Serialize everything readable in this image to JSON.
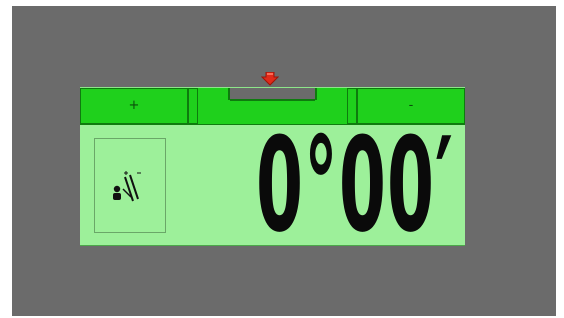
{
  "panel": {
    "plus_label": "+",
    "minus_label": "-",
    "reading": "0°00′"
  },
  "colors": {
    "background": "#6b6b6b",
    "button_green": "#1fd01c",
    "display_green": "#9df09a",
    "marker_red": "#e02a1a",
    "digits": "#0a0a0a"
  },
  "icons": {
    "marker": "red-down-arrow-icon",
    "tool": "tool-adjust-icon"
  }
}
